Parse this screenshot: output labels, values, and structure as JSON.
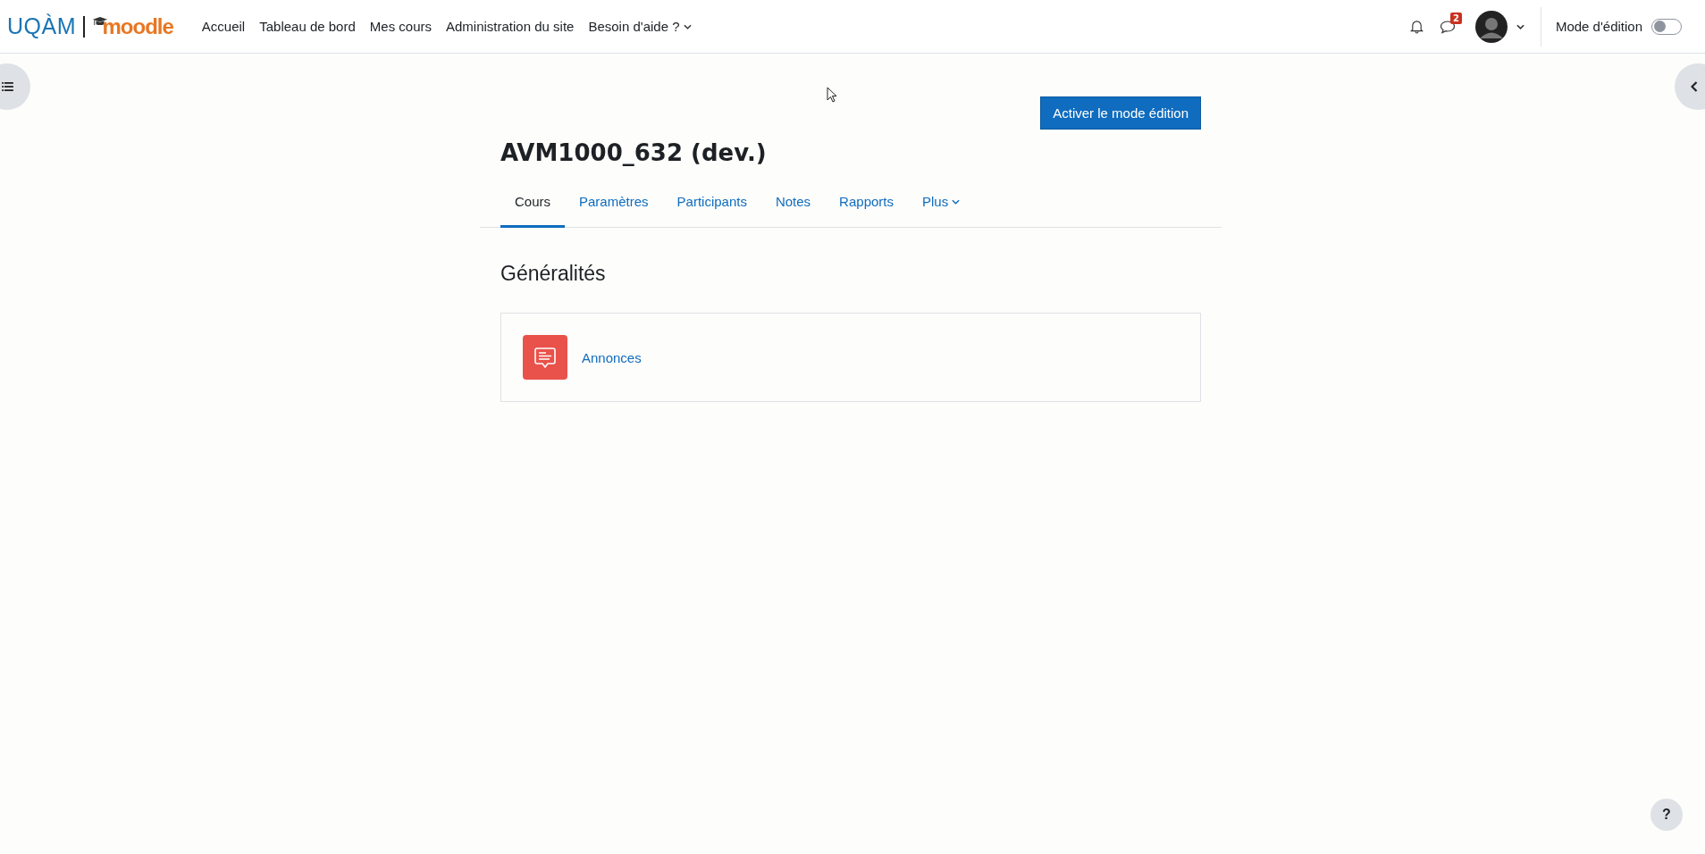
{
  "header": {
    "logo": {
      "institution": "UQÀM",
      "product": "moodle"
    },
    "nav": [
      {
        "label": "Accueil",
        "dropdown": false
      },
      {
        "label": "Tableau de bord",
        "dropdown": false
      },
      {
        "label": "Mes cours",
        "dropdown": false
      },
      {
        "label": "Administration du site",
        "dropdown": false
      },
      {
        "label": "Besoin d'aide ?",
        "dropdown": true
      }
    ],
    "message_count": "2",
    "edit_mode": {
      "label": "Mode d'édition",
      "on": false
    }
  },
  "page": {
    "action_button": "Activer le mode édition",
    "title": "AVM1000_632 (dev.)",
    "tabs": [
      {
        "label": "Cours",
        "selected": true,
        "dropdown": false
      },
      {
        "label": "Paramètres",
        "selected": false,
        "dropdown": false
      },
      {
        "label": "Participants",
        "selected": false,
        "dropdown": false
      },
      {
        "label": "Notes",
        "selected": false,
        "dropdown": false
      },
      {
        "label": "Rapports",
        "selected": false,
        "dropdown": false
      },
      {
        "label": "Plus",
        "selected": false,
        "dropdown": true
      }
    ],
    "section": {
      "title": "Généralités",
      "activities": [
        {
          "name": "Annonces",
          "kind": "forum"
        }
      ]
    }
  },
  "help_button": "?"
}
